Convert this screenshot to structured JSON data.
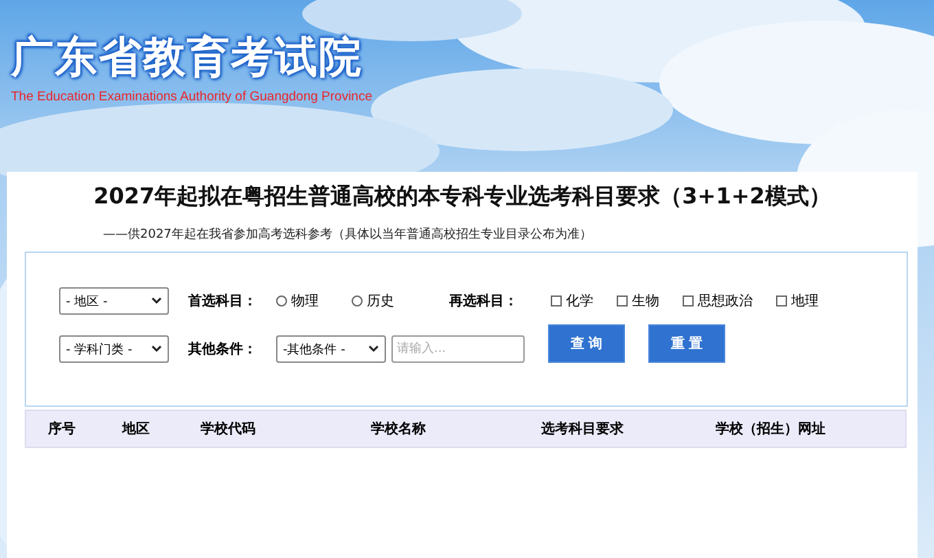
{
  "header": {
    "title": "广东省教育考试院",
    "subtitle": "The Education Examinations Authority of Guangdong Province"
  },
  "page": {
    "title": "2027年起拟在粤招生普通高校的本专科专业选考科目要求（3+1+2模式）",
    "note": "——供2027年起在我省参加高考选科参考（具体以当年普通高校招生专业目录公布为准）"
  },
  "filters": {
    "region_select": "- 地区 -",
    "first_label": "首选科目：",
    "first_options": [
      {
        "label": "物理",
        "selected": false
      },
      {
        "label": "历史",
        "selected": false
      }
    ],
    "second_label": "再选科目：",
    "second_options": [
      {
        "label": "化学",
        "checked": false
      },
      {
        "label": "生物",
        "checked": false
      },
      {
        "label": "思想政治",
        "checked": false
      },
      {
        "label": "地理",
        "checked": false
      }
    ],
    "category_select": "- 学科门类 -",
    "other_label": "其他条件：",
    "other_select": "-其他条件 -",
    "search": {
      "placeholder": "请输入..."
    },
    "buttons": [
      "查 询",
      "重 置"
    ]
  },
  "table": {
    "columns": [
      "序号",
      "地区",
      "学校代码",
      "学校名称",
      "选考科目要求",
      "学校（招生）网址"
    ]
  }
}
